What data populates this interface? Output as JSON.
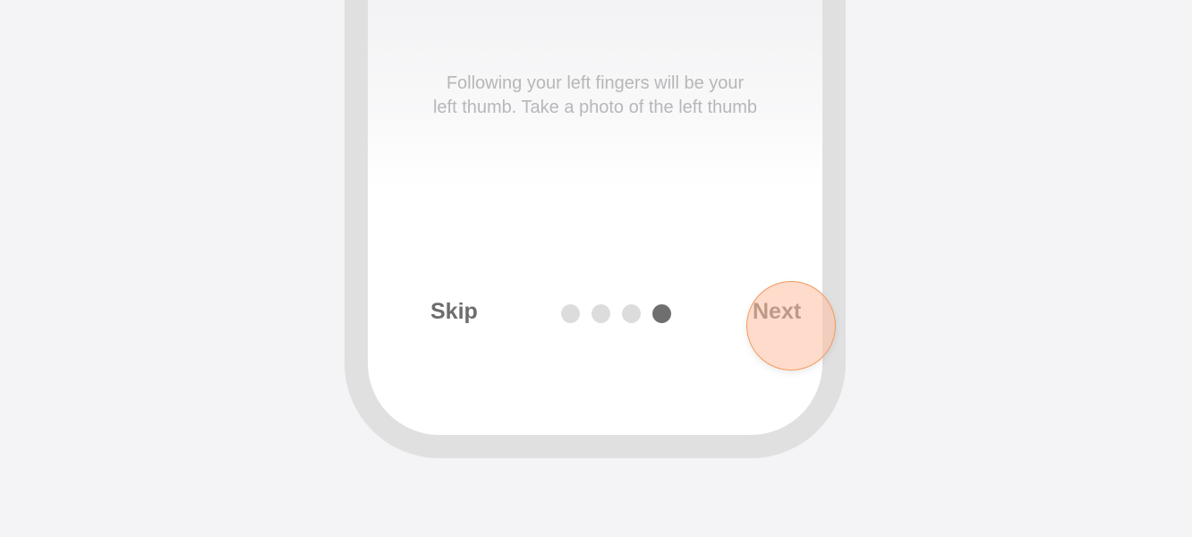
{
  "onboarding": {
    "instruction_line1": "Following your left fingers will be your",
    "instruction_line2": "left thumb. Take a photo of the left thumb",
    "skip_label": "Skip",
    "next_label": "Next",
    "page_indicator": {
      "total": 4,
      "current": 4
    }
  },
  "colors": {
    "background": "#f4f4f6",
    "frame": "#e0e0e0",
    "text_muted": "#b7b7b9",
    "button_text": "#6d6d6f",
    "dot_inactive": "#dcdcdc",
    "dot_active": "#6f6f6f",
    "touch_fill": "#ffbea0",
    "touch_border": "#f29a5e"
  }
}
